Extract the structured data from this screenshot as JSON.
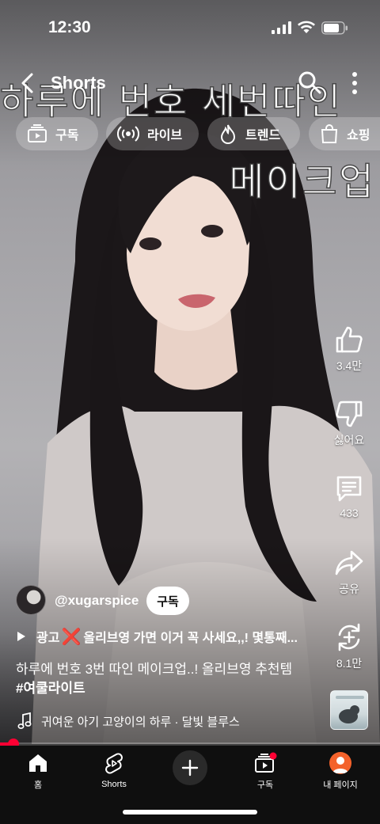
{
  "status_bar": {
    "time": "12:30"
  },
  "header": {
    "title": "Shorts"
  },
  "chips": [
    {
      "label": "구독",
      "icon": "subscriptions-icon"
    },
    {
      "label": "라이브",
      "icon": "live-icon"
    },
    {
      "label": "트렌드",
      "icon": "trending-icon"
    },
    {
      "label": "쇼핑",
      "icon": "shopping-bag-icon"
    }
  ],
  "video": {
    "overlay_caption_line1": "하루에 번호 세번따인",
    "overlay_caption_line2": "메이크업"
  },
  "actions": {
    "like": "3.4만",
    "dislike": "싫어요",
    "comments": "433",
    "share": "공유",
    "remix": "8.1만"
  },
  "channel": {
    "handle": "@xugarspice",
    "subscribe_label": "구독"
  },
  "promo": {
    "prefix": "광고",
    "mark": "❌",
    "text": "올리브영 가면 이거 꼭 사세요,,! 몇통째..."
  },
  "caption": {
    "text": "하루에 번호 3번 따인 메이크업..! 올리브영 추천템",
    "hashtag": "#여쿨라이트"
  },
  "music": {
    "text": "귀여운 아기 고양이의 하루 · 달빛 블루스"
  },
  "progress": {
    "fraction": 0.035
  },
  "bottom_nav": {
    "home": "홈",
    "shorts": "Shorts",
    "subscriptions": "구독",
    "me": "내 페이지"
  },
  "colors": {
    "accent": "#ff0033",
    "nav_background": "#0f0f0f",
    "profile": "#f4622b"
  }
}
